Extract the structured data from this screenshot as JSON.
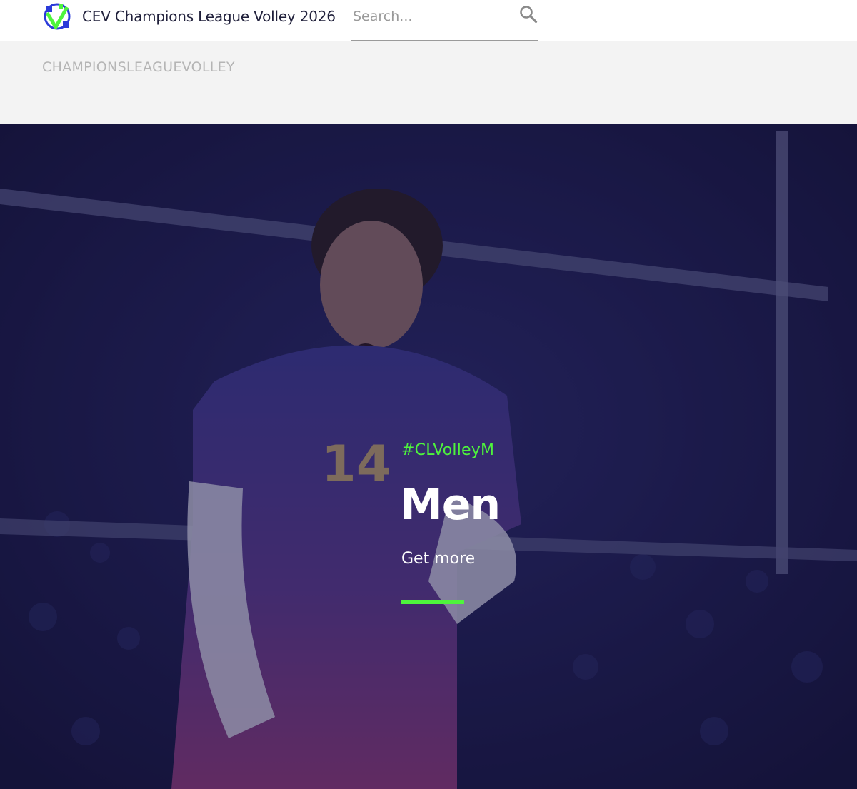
{
  "header": {
    "site_title": "CEV Champions League Volley 2026",
    "search": {
      "placeholder": "Search...",
      "value": ""
    }
  },
  "breadcrumb": {
    "label": "CHAMPIONSLEAGUEVOLLEY"
  },
  "hero": {
    "tag": "#CLVolleyM",
    "title": "Men",
    "cta_label": "Get more",
    "image": "volleyball-player-celebrating-photo",
    "overlay_color": "#1d1b4c",
    "accent_color": "#4ef43c"
  },
  "colors": {
    "brand_blue": "#2b3bd9",
    "brand_green": "#4ef43c",
    "text_dark": "#1f1f3a",
    "band_grey": "#f3f3f3"
  },
  "icons": {
    "logo": "cev-logo-icon",
    "search": "search-icon"
  }
}
